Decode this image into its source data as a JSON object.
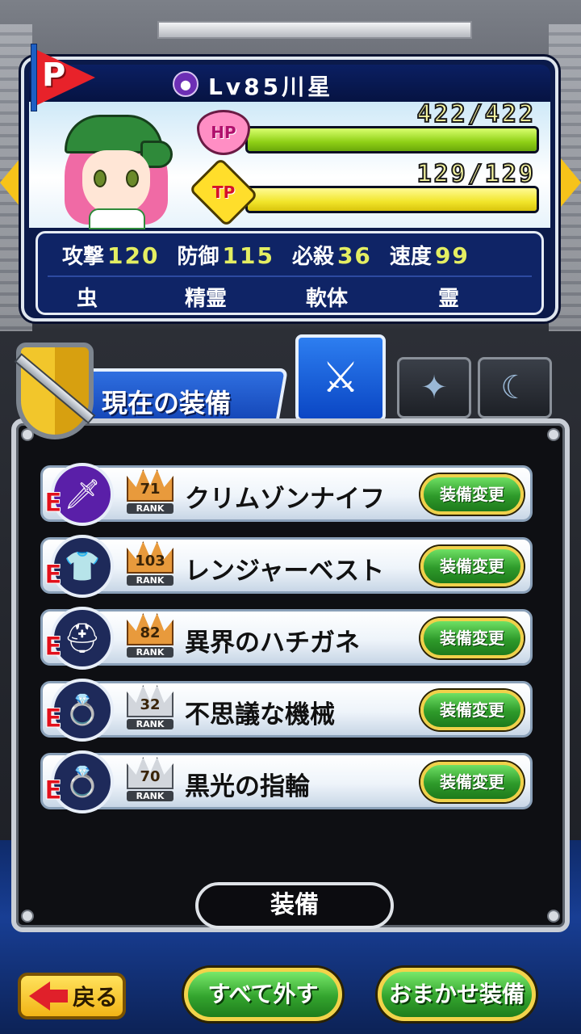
{
  "character": {
    "level_label": "Lv85",
    "name": "川星",
    "hp_label": "HP",
    "hp_value": "422/422",
    "hp_fraction": 1.0,
    "tp_label": "TP",
    "tp_value": "129/129",
    "tp_fraction": 1.0,
    "flag_letter": "P"
  },
  "stats": [
    {
      "label": "攻撃",
      "value": "120"
    },
    {
      "label": "防御",
      "value": "115"
    },
    {
      "label": "必殺",
      "value": "36"
    },
    {
      "label": "速度",
      "value": "99"
    }
  ],
  "attributes": [
    "虫",
    "精霊",
    "軟体",
    "霊"
  ],
  "equip_section": {
    "title": "現在の装備",
    "footer_label": "装備"
  },
  "equipment": [
    {
      "grade": "E",
      "rank": "71",
      "rank_label": "RANK",
      "name": "クリムゾンナイフ",
      "button": "装備変更",
      "icon": "knife-icon"
    },
    {
      "grade": "E",
      "rank": "103",
      "rank_label": "RANK",
      "name": "レンジャーベスト",
      "button": "装備変更",
      "icon": "shirt-icon"
    },
    {
      "grade": "E",
      "rank": "82",
      "rank_label": "RANK",
      "name": "異界のハチガネ",
      "button": "装備変更",
      "icon": "helmet-icon"
    },
    {
      "grade": "E",
      "rank": "32",
      "rank_label": "RANK",
      "name": "不思議な機械",
      "button": "装備変更",
      "icon": "ring-icon"
    },
    {
      "grade": "E",
      "rank": "70",
      "rank_label": "RANK",
      "name": "黒光の指輪",
      "button": "装備変更",
      "icon": "ring-icon"
    }
  ],
  "buttons": {
    "back": "戻る",
    "unequip_all": "すべて外す",
    "auto_equip": "おまかせ装備"
  }
}
